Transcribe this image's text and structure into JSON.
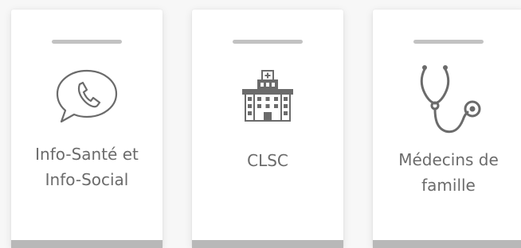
{
  "cards": [
    {
      "icon": "phone-speech-bubble-icon",
      "label_lines": [
        "Info-Santé et",
        "Info-Social"
      ]
    },
    {
      "icon": "hospital-building-icon",
      "label_lines": [
        "CLSC"
      ]
    },
    {
      "icon": "stethoscope-icon",
      "label_lines": [
        "Médecins de",
        "famille"
      ]
    }
  ],
  "colors": {
    "card_background": "#ffffff",
    "page_background": "#f7f7f7",
    "accent_bar": "#c2c2c2",
    "bottom_bar": "#b8b8b8",
    "text": "#6b6b6b",
    "icon_stroke": "#6b6b6b"
  }
}
